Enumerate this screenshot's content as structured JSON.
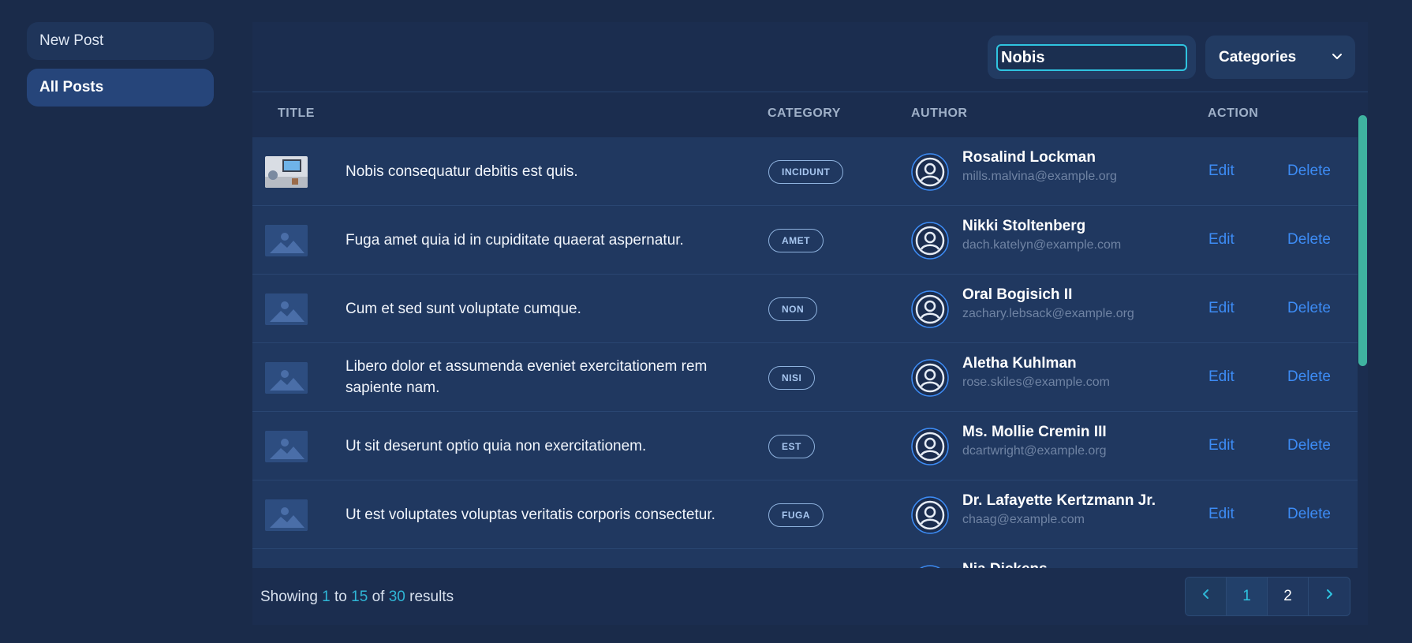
{
  "sidebar": {
    "items": [
      {
        "label": "New Post",
        "active": false
      },
      {
        "label": "All Posts",
        "active": true
      }
    ]
  },
  "toolbar": {
    "search_value": "Nobis",
    "categories_label": "Categories"
  },
  "table": {
    "headers": {
      "title": "TITLE",
      "category": "CATEGORY",
      "author": "AUTHOR",
      "action": "ACTION"
    },
    "edit_label": "Edit",
    "delete_label": "Delete",
    "rows": [
      {
        "title": "Nobis consequatur debitis est quis.",
        "category": "INCIDUNT",
        "author": "Rosalind Lockman",
        "email": "mills.malvina@example.org",
        "thumb": "photo"
      },
      {
        "title": "Fuga amet quia id in cupiditate quaerat aspernatur.",
        "category": "AMET",
        "author": "Nikki Stoltenberg",
        "email": "dach.katelyn@example.com",
        "thumb": "placeholder"
      },
      {
        "title": "Cum et sed sunt voluptate cumque.",
        "category": "NON",
        "author": "Oral Bogisich II",
        "email": "zachary.lebsack@example.org",
        "thumb": "placeholder"
      },
      {
        "title": "Libero dolor et assumenda eveniet exercitationem rem sapiente nam.",
        "category": "NISI",
        "author": "Aletha Kuhlman",
        "email": "rose.skiles@example.com",
        "thumb": "placeholder"
      },
      {
        "title": "Ut sit deserunt optio quia non exercitationem.",
        "category": "EST",
        "author": "Ms. Mollie Cremin III",
        "email": "dcartwright@example.org",
        "thumb": "placeholder"
      },
      {
        "title": "Ut est voluptates voluptas veritatis corporis consectetur.",
        "category": "FUGA",
        "author": "Dr. Lafayette Kertzmann Jr.",
        "email": "chaag@example.com",
        "thumb": "placeholder"
      },
      {
        "title": "",
        "category": "",
        "author": "Nia Dickens",
        "email": "",
        "thumb": "placeholder"
      }
    ]
  },
  "footer": {
    "showing": "Showing",
    "from": "1",
    "to_word": "to",
    "to": "15",
    "of_word": "of",
    "total": "30",
    "results": "results",
    "pages": [
      "1",
      "2"
    ],
    "current_page": "1"
  },
  "colors": {
    "background": "#1a2b4a",
    "panel": "#1b2d4f",
    "accent": "#2fc4e0",
    "link": "#3d8cf5",
    "scroll_thumb": "#3fb3a0"
  },
  "icons": {
    "avatar": "user-circle-icon",
    "dropdown": "chevron-down-icon",
    "prev": "chevron-left-icon",
    "next": "chevron-right-icon",
    "placeholder": "image-placeholder-icon"
  }
}
